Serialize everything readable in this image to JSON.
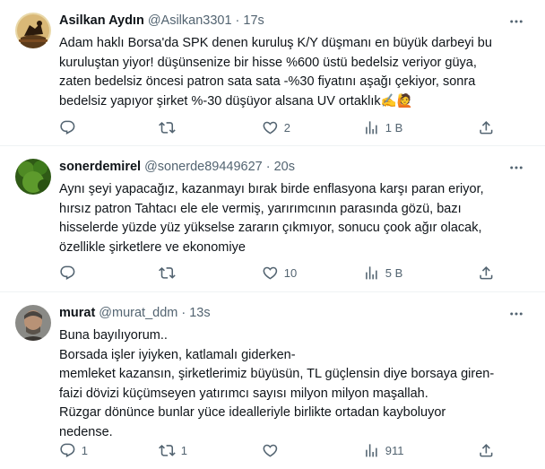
{
  "tweets": [
    {
      "name": "Asilkan Aydın",
      "handle": "@Asilkan3301",
      "separator": "·",
      "time": "17s",
      "lines": [
        "Adam haklı Borsa'da SPK denen kuruluş K/Y düşmanı en büyük darbeyi bu",
        "kuruluştan yiyor! düşünsenize bir hisse %600 üstü bedelsiz veriyor güya,",
        "zaten bedelsiz öncesi patron sata sata -%30 fiyatını aşağı çekiyor, sonra",
        "bedelsiz yapıyor şirket %-30 düşüyor alsana UV ortaklık✍️🙋"
      ],
      "replies": "",
      "retweets": "",
      "likes": "2",
      "views": "1 B"
    },
    {
      "name": "sonerdemirel",
      "handle": "@sonerde89449627",
      "separator": "·",
      "time": "20s",
      "lines": [
        "Aynı şeyi yapacağız, kazanmayı bırak birde enflasyona karşı paran eriyor,",
        "hırsız patron Tahtacı ele ele vermiş, yarırımcının parasında gözü, bazı",
        "hisselerde yüzde yüz yükselse zararın çıkmıyor, sonucu çook ağır olacak,",
        "özellikle şirketlere ve ekonomiye"
      ],
      "replies": "",
      "retweets": "",
      "likes": "10",
      "views": "5 B"
    },
    {
      "name": "murat",
      "handle": "@murat_ddm",
      "separator": "·",
      "time": "13s",
      "lines": [
        "Buna bayılıyorum..",
        "Borsada işler iyiyken, katlamalı giderken-",
        "memleket kazansın, şirketlerimiz büyüsün, TL güçlensin diye borsaya giren-",
        "faizi dövizi küçümseyen yatırımcı sayısı milyon milyon maşallah.",
        "Rüzgar dönünce bunlar yüce idealleriyle birlikte ortadan kayboluyor",
        "nedense."
      ],
      "replies": "1",
      "retweets": "1",
      "likes": "",
      "views": "911"
    }
  ],
  "colors": {
    "text": "#0f1419",
    "secondary": "#536471",
    "divider": "#eff3f4"
  },
  "icons": [
    "more-icon",
    "reply-icon",
    "retweet-icon",
    "like-icon",
    "views-icon",
    "bookmark-icon",
    "share-icon"
  ]
}
